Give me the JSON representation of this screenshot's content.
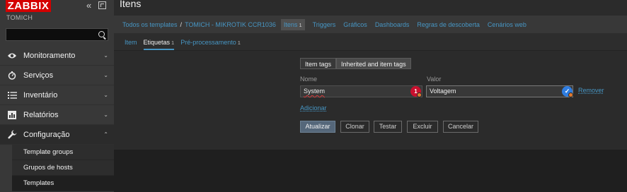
{
  "sidebar": {
    "logo": "ZABBIX",
    "server_name": "TOMICH",
    "search": {
      "value": "",
      "placeholder": ""
    },
    "menu": [
      {
        "label": "Monitoramento",
        "icon": "eye-icon"
      },
      {
        "label": "Serviços",
        "icon": "clock-icon"
      },
      {
        "label": "Inventário",
        "icon": "list-icon"
      },
      {
        "label": "Relatórios",
        "icon": "bar-chart-icon"
      },
      {
        "label": "Configuração",
        "icon": "wrench-icon",
        "expanded": true
      }
    ],
    "submenu": [
      {
        "label": "Template groups"
      },
      {
        "label": "Grupos de hosts"
      },
      {
        "label": "Templates",
        "selected": true
      }
    ]
  },
  "page": {
    "title": "Itens"
  },
  "breadcrumb": {
    "items": [
      "Todos os templates",
      "TOMICH - MIKROTIK CCR1036"
    ],
    "current": {
      "label": "Itens",
      "count": "1"
    },
    "tabs": [
      "Triggers",
      "Gráficos",
      "Dashboards",
      "Regras de descoberta",
      "Cenários web"
    ]
  },
  "tabs": [
    {
      "label": "Item",
      "count": ""
    },
    {
      "label": "Etiquetas",
      "count": "1",
      "active": true
    },
    {
      "label": "Pré-processamento",
      "count": "1"
    }
  ],
  "tag_form": {
    "subtabs": [
      "Item tags",
      "Inherited and item tags"
    ],
    "name_label": "Nome",
    "value_label": "Valor",
    "name_value": "System",
    "value_value": "Voltagem",
    "name_badge": "1",
    "value_badge": "✓",
    "remove_label": "Remover",
    "add_label": "Adicionar"
  },
  "buttons": {
    "update": "Atualizar",
    "clone": "Clonar",
    "test": "Testar",
    "delete": "Excluir",
    "cancel": "Cancelar"
  },
  "colors": {
    "logo_red": "#d40000",
    "link_blue": "#4796c4",
    "badge_red": "#c8102e",
    "badge_blue": "#2f7de0"
  }
}
